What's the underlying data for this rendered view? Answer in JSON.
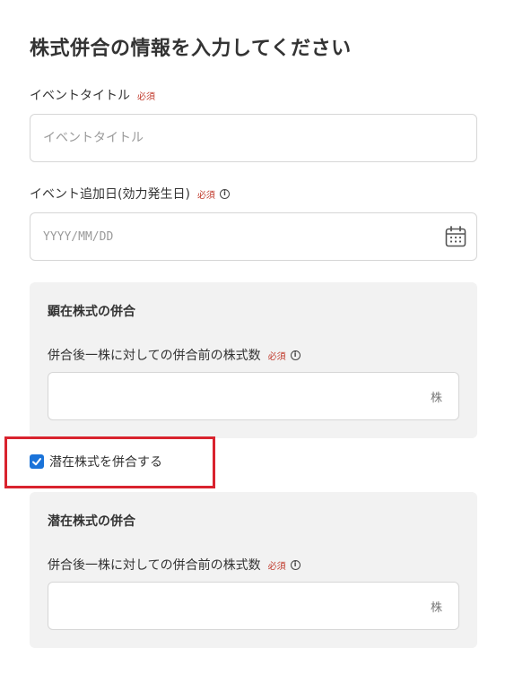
{
  "page_title": "株式併合の情報を入力してください",
  "event_title": {
    "label": "イベントタイトル",
    "required": "必須",
    "placeholder": "イベントタイトル",
    "value": ""
  },
  "event_date": {
    "label": "イベント追加日(効力発生日)",
    "required": "必須",
    "info": "i",
    "placeholder": "YYYY/MM/DD",
    "value": ""
  },
  "visible_shares_panel": {
    "title": "顕在株式の併合",
    "field_label": "併合後一株に対しての併合前の株式数",
    "required": "必須",
    "info": "i",
    "unit": "株",
    "value": ""
  },
  "latent_checkbox": {
    "label": "潜在株式を併合する",
    "checked": true
  },
  "latent_shares_panel": {
    "title": "潜在株式の併合",
    "field_label": "併合後一株に対しての併合前の株式数",
    "required": "必須",
    "info": "i",
    "unit": "株",
    "value": ""
  },
  "colors": {
    "accent": "#1a73d9",
    "highlight_border": "#d9232e",
    "required_text": "#c0392b",
    "panel_bg": "#f2f2f2"
  }
}
